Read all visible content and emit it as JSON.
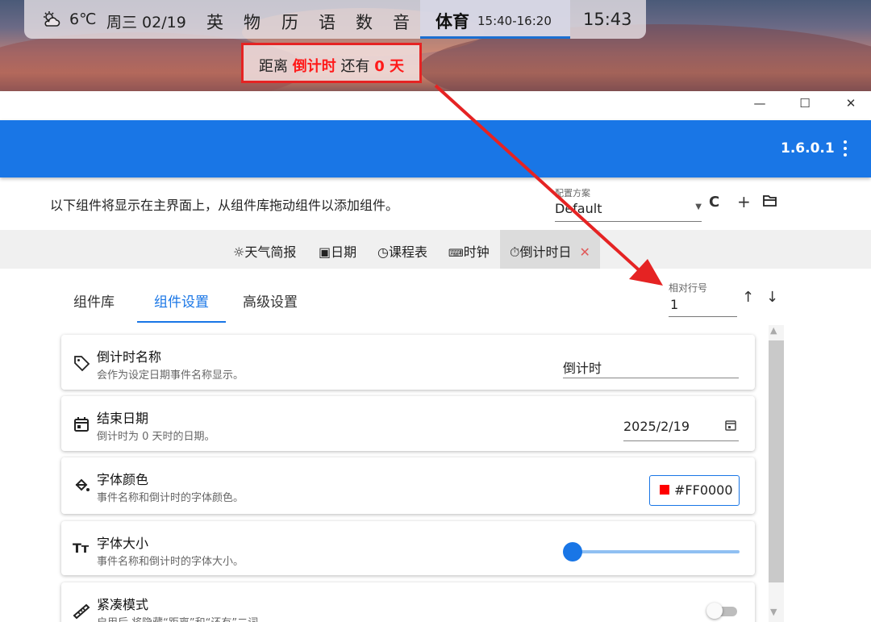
{
  "topbar": {
    "weather_icon": "partly-cloudy-icon",
    "temperature": "6℃",
    "date": "周三 02/19",
    "classes": [
      "英",
      "物",
      "历",
      "语",
      "数",
      "音"
    ],
    "current_class": "体育",
    "current_time_range": "15:40-16:20",
    "clock": "15:43"
  },
  "countdown": {
    "prefix": "距离 ",
    "event": "倒计时",
    "middle": " 还有 ",
    "days": "0",
    "suffix": " 天",
    "highlight_color": "#FF1A1A"
  },
  "window": {
    "minimize": "—",
    "maximize": "☐",
    "close": "✕"
  },
  "appbar": {
    "version": "1.6.0.1",
    "accent": "#1976E6"
  },
  "toolbar": {
    "hint": "以下组件将显示在主界面上，从组件库拖动组件以添加组件。",
    "profile_label": "配置方案",
    "profile_value": "Default",
    "refresh_icon": "C",
    "add_icon": "+",
    "folder_icon": "folder-icon"
  },
  "widgets": [
    {
      "icon": "sun-icon",
      "label": "天气简报"
    },
    {
      "icon": "calendar-icon",
      "label": "日期"
    },
    {
      "icon": "clock-icon",
      "label": "课程表"
    },
    {
      "icon": "keyboard-icon",
      "label": "时钟"
    },
    {
      "icon": "timer-icon",
      "label": "倒计时日"
    }
  ],
  "tabs": [
    "组件库",
    "组件设置",
    "高级设置"
  ],
  "active_tab": "组件设置",
  "row_field": {
    "label": "相对行号",
    "value": "1"
  },
  "settings": [
    {
      "icon": "tag-icon",
      "title": "倒计时名称",
      "desc": "会作为设定日期事件名称显示。",
      "value": "倒计时"
    },
    {
      "icon": "calendar-icon",
      "title": "结束日期",
      "desc": "倒计时为 0 天时的日期。",
      "value": "2025/2/19"
    },
    {
      "icon": "paint-bucket-icon",
      "title": "字体颜色",
      "desc": "事件名称和倒计时的字体颜色。",
      "value": "#FF0000",
      "swatch": "#FF0000"
    },
    {
      "icon": "font-size-icon",
      "title": "字体大小",
      "desc": "事件名称和倒计时的字体大小。",
      "slider_fraction": 0.0
    },
    {
      "icon": "ruler-icon",
      "title": "紧凑模式",
      "desc": "启用后,将隐藏“距离”和“还有”二词。",
      "toggle": false
    }
  ],
  "annotation_color": "#E52323"
}
